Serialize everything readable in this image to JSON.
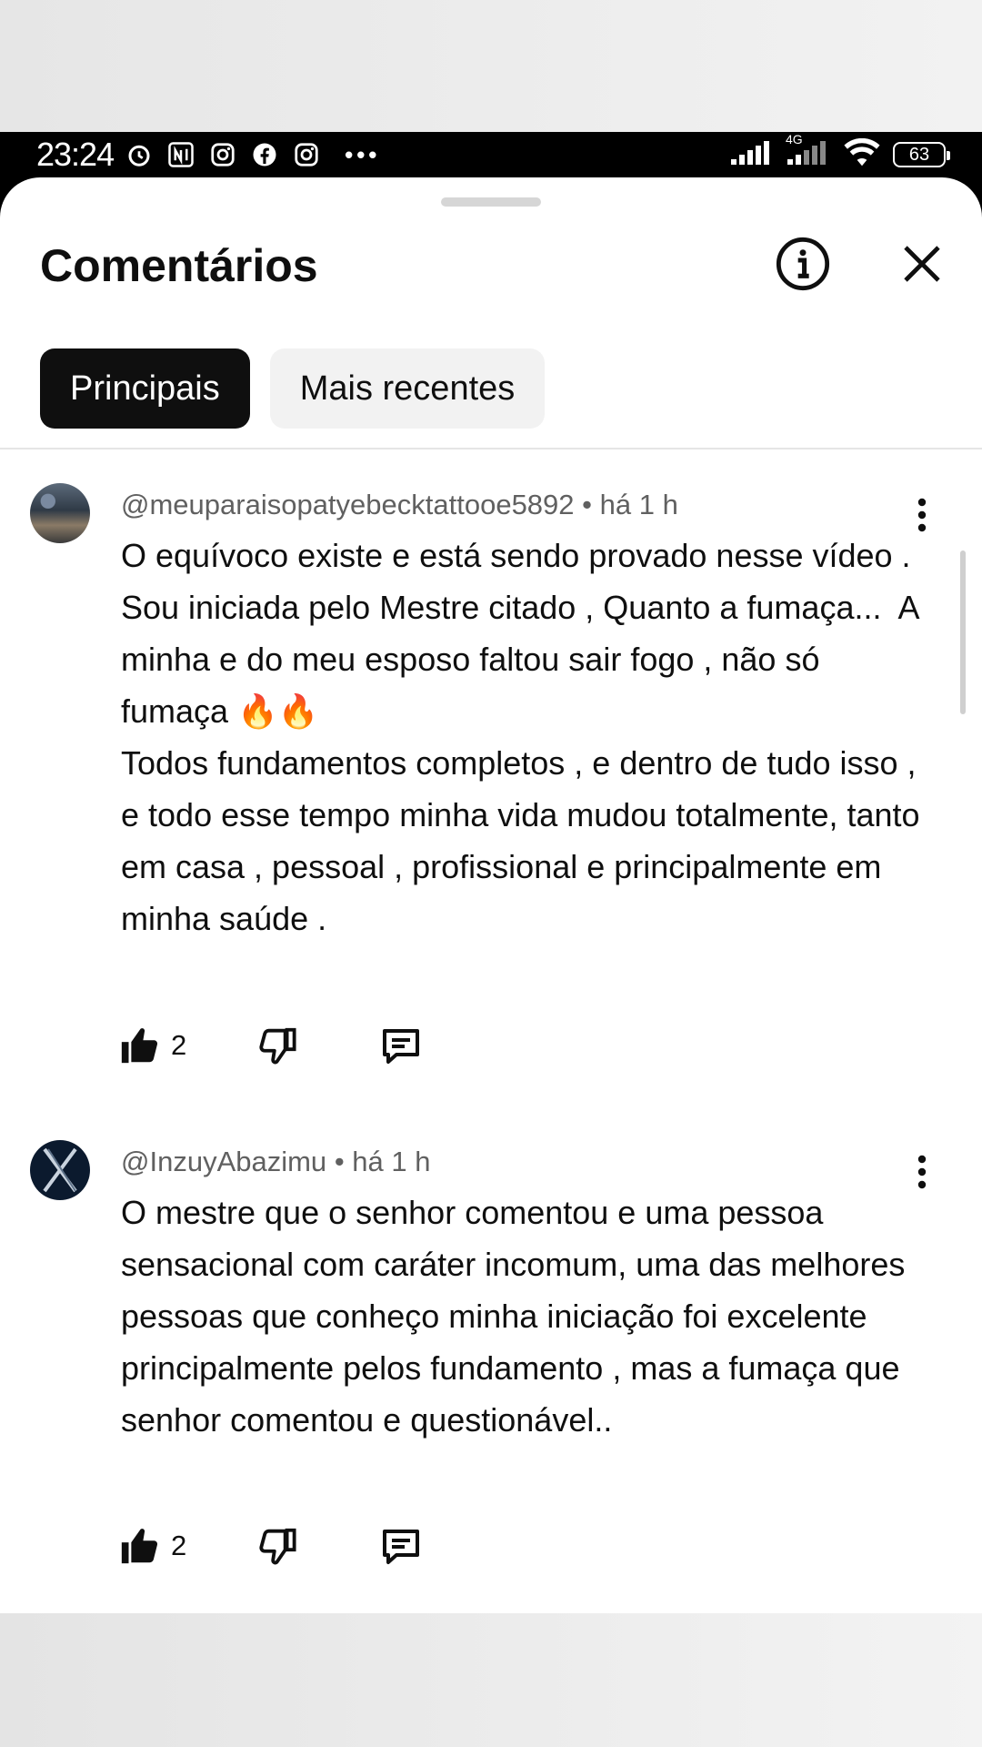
{
  "status_bar": {
    "time": "23:24",
    "battery": "63",
    "network": "4G"
  },
  "sheet": {
    "title": "Comentários",
    "chips": [
      {
        "label": "Principais",
        "active": true
      },
      {
        "label": "Mais recentes",
        "active": false
      }
    ]
  },
  "comments": [
    {
      "author": "@meuparaisopatyebecktattooe5892",
      "time": "• há 1 h",
      "lines": [
        "O equívoco existe e está sendo provado nesse vídeo .",
        "Sou iniciada pelo Mestre citado , Quanto a fumaça...  A minha e do meu esposo faltou sair fogo , não só fumaça 🔥🔥",
        "Todos fundamentos completos , e dentro de tudo isso , e todo esse tempo minha vida mudou totalmente, tanto em casa , pessoal , profissional e principalmente em minha saúde ."
      ],
      "likes": "2"
    },
    {
      "author": "@InzuyAbazimu",
      "time": "• há 1 h",
      "lines": [
        "O mestre que o senhor comentou e uma pessoa sensacional com caráter incomum, uma das melhores pessoas que conheço minha iniciação foi excelente principalmente pelos fundamento , mas a fumaça que senhor comentou e questionável.."
      ],
      "likes": "2"
    }
  ],
  "icons": {
    "info": "info-icon",
    "close": "close-icon",
    "more": "more-vert-icon",
    "like": "thumb-up-icon",
    "dislike": "thumb-down-icon",
    "reply": "reply-icon"
  }
}
